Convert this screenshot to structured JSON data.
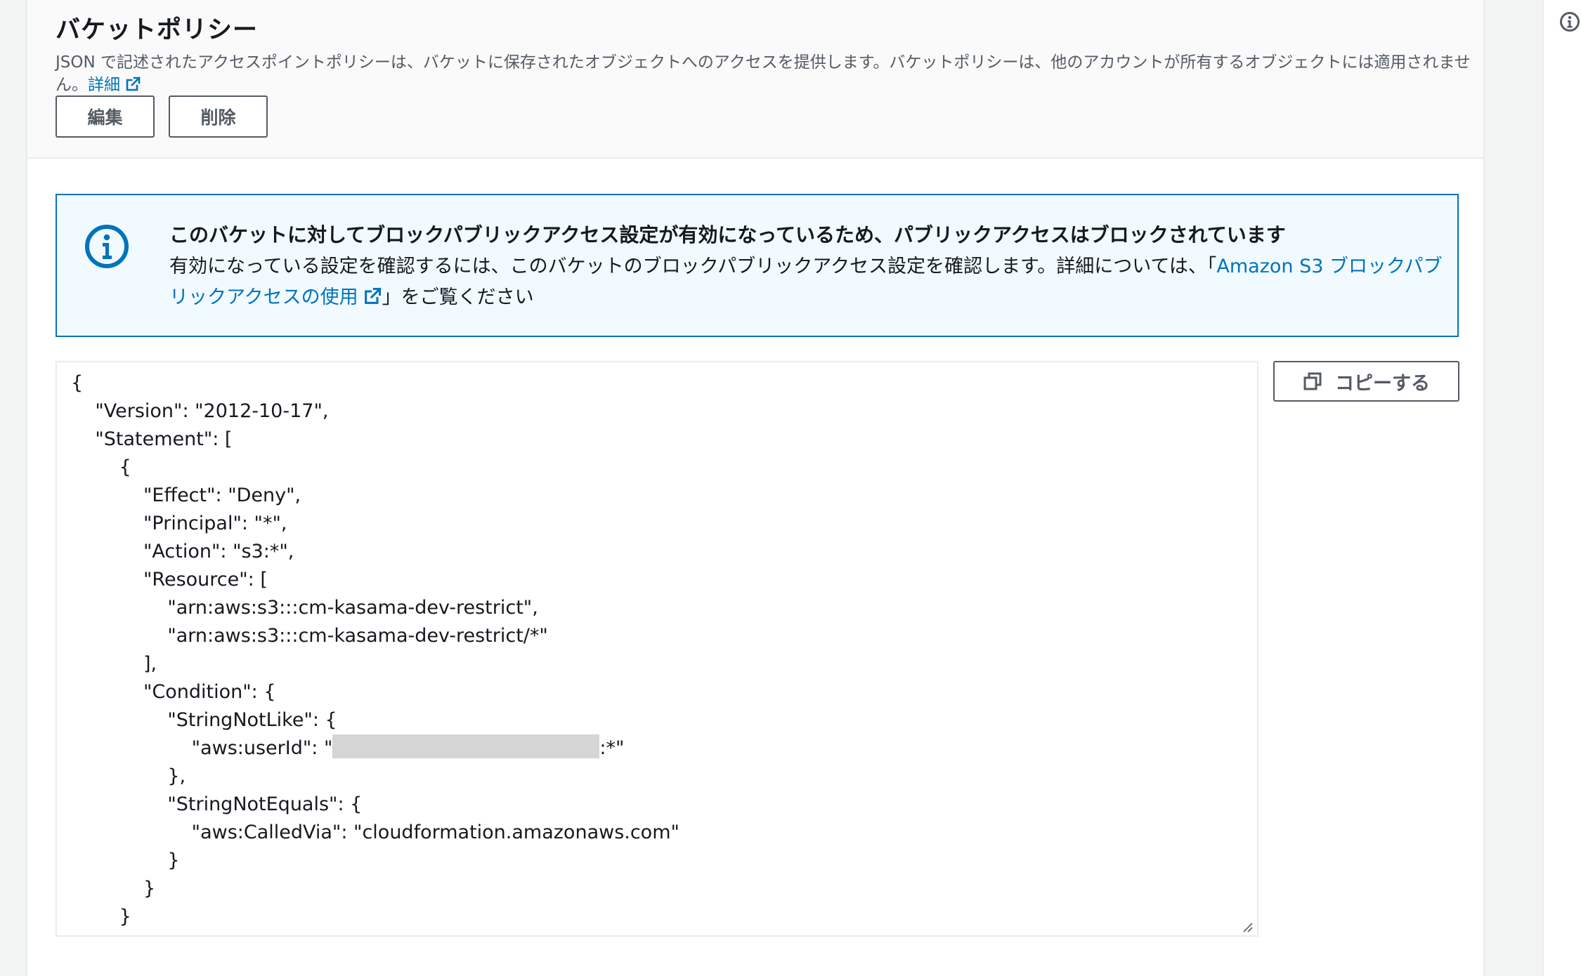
{
  "header": {
    "title": "バケットポリシー",
    "description": "JSON で記述されたアクセスポイントポリシーは、バケットに保存されたオブジェクトへのアクセスを提供します。バケットポリシーは、他のアカウントが所有するオブジェクトには適用されません。",
    "detail_link": "詳細",
    "edit_label": "編集",
    "delete_label": "削除"
  },
  "alert": {
    "title": "このバケットに対してブロックパブリックアクセス設定が有効になっているため、パブリックアクセスはブロックされています",
    "body_prefix": "有効になっている設定を確認するには、このバケットのブロックパブリックアクセス設定を確認します。詳細については、「",
    "link_text": "Amazon S3 ブロックパブリックアクセスの使用",
    "body_suffix": "」をご覧ください"
  },
  "copy_button_label": "コピーする",
  "policy_lines": [
    "{",
    "    \"Version\": \"2012-10-17\",",
    "    \"Statement\": [",
    "        {",
    "            \"Effect\": \"Deny\",",
    "            \"Principal\": \"*\",",
    "            \"Action\": \"s3:*\",",
    "            \"Resource\": [",
    "                \"arn:aws:s3:::cm-kasama-dev-restrict\",",
    "                \"arn:aws:s3:::cm-kasama-dev-restrict/*\"",
    "            ],",
    "            \"Condition\": {",
    "                \"StringNotLike\": {",
    "                    \"aws:userId\": \"",
    "                },",
    "                \"StringNotEquals\": {",
    "                    \"aws:CalledVia\": \"cloudformation.amazonaws.com\"",
    "                }",
    "            }",
    "        }"
  ],
  "redacted_suffix": ":*\"",
  "colors": {
    "link": "#0073bb",
    "alert_bg": "#f1faff",
    "alert_border": "#0073bb",
    "button_border": "#545b64"
  },
  "icons": {
    "external_link": "external-link-icon",
    "info": "info-icon",
    "copy": "copy-icon"
  }
}
